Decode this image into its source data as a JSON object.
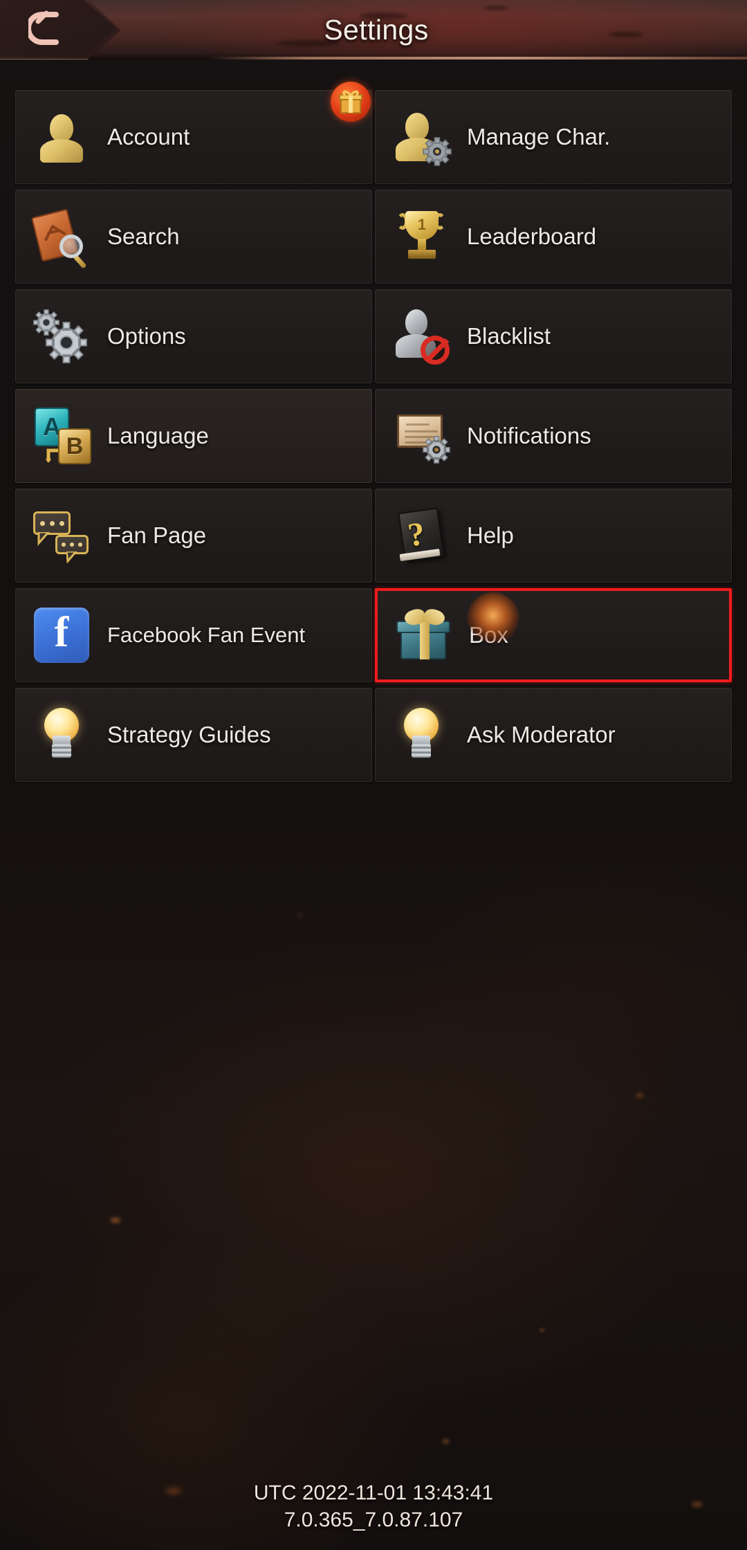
{
  "header": {
    "title": "Settings",
    "back_icon": "back-arrow-icon"
  },
  "badges": {
    "account_gift": "gift-badge-icon"
  },
  "menu": {
    "items": [
      {
        "label": "Account",
        "icon": "person-icon",
        "highlighted": false,
        "selected": false,
        "badge": "gift"
      },
      {
        "label": "Manage Char.",
        "icon": "person-gear-icon",
        "highlighted": false,
        "selected": false,
        "badge": ""
      },
      {
        "label": "Search",
        "icon": "book-magnifier-icon",
        "highlighted": false,
        "selected": false,
        "badge": ""
      },
      {
        "label": "Leaderboard",
        "icon": "trophy-icon",
        "highlighted": false,
        "selected": false,
        "badge": ""
      },
      {
        "label": "Options",
        "icon": "gears-icon",
        "highlighted": false,
        "selected": false,
        "badge": ""
      },
      {
        "label": "Blacklist",
        "icon": "person-blocked-icon",
        "highlighted": false,
        "selected": false,
        "badge": ""
      },
      {
        "label": "Language",
        "icon": "language-ab-icon",
        "highlighted": true,
        "selected": false,
        "badge": ""
      },
      {
        "label": "Notifications",
        "icon": "parchment-gear-icon",
        "highlighted": false,
        "selected": false,
        "badge": ""
      },
      {
        "label": "Fan Page",
        "icon": "speech-bubbles-icon",
        "highlighted": false,
        "selected": false,
        "badge": ""
      },
      {
        "label": "Help",
        "icon": "question-book-icon",
        "highlighted": false,
        "selected": false,
        "badge": ""
      },
      {
        "label": "Facebook Fan Event",
        "icon": "facebook-icon",
        "highlighted": false,
        "selected": false,
        "badge": ""
      },
      {
        "label": "Box",
        "icon": "gift-box-icon",
        "highlighted": false,
        "selected": true,
        "badge": ""
      },
      {
        "label": "Strategy Guides",
        "icon": "lightbulb-icon",
        "highlighted": false,
        "selected": false,
        "badge": ""
      },
      {
        "label": "Ask Moderator",
        "icon": "lightbulb-icon",
        "highlighted": false,
        "selected": false,
        "badge": ""
      }
    ],
    "language_tile_a": "A",
    "language_tile_b": "B",
    "trophy_rank": "1",
    "facebook_glyph": "f",
    "help_glyph": "?"
  },
  "footer": {
    "timestamp": "UTC  2022-11-01 13:43:41",
    "version": "7.0.365_7.0.87.107"
  },
  "colors": {
    "selection_border": "#ef1c1c",
    "header_accent": "#d7aa8c",
    "facebook_blue": "#3b6fd4",
    "gold": "#e2c570"
  }
}
